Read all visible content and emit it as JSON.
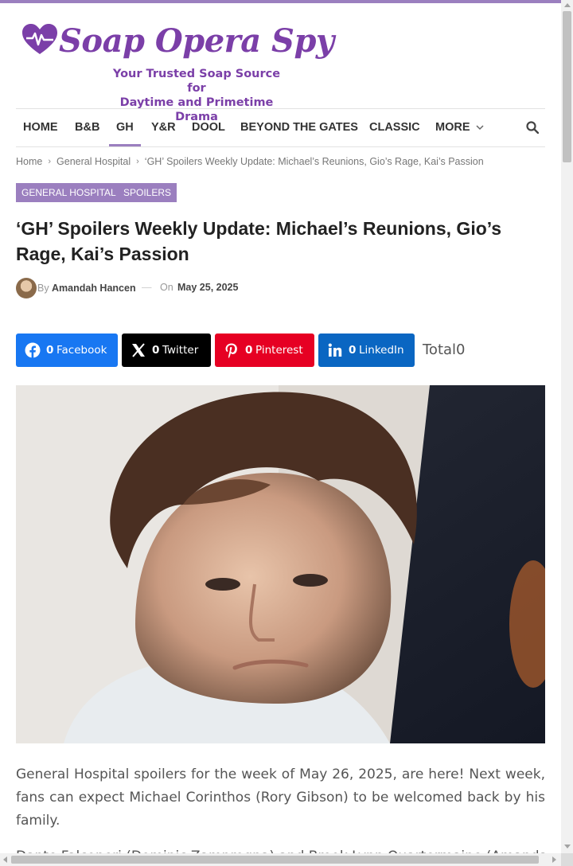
{
  "brand": {
    "name": "Soap Opera Spy",
    "tagline_line1": "Your Trusted Soap Source for",
    "tagline_line2": "Daytime and Primetime Drama",
    "accent_color": "#9b7fbf",
    "logo_color": "#7b3fa8"
  },
  "nav": {
    "items": [
      "HOME",
      "B&B",
      "GH",
      "Y&R",
      "DOOL",
      "BEYOND THE GATES",
      "CLASSIC",
      "MORE"
    ],
    "active": "GH",
    "search_icon": "search-icon"
  },
  "breadcrumb": {
    "items": [
      "Home",
      "General Hospital",
      "‘GH’ Spoilers Weekly Update: Michael’s Reunions, Gio’s Rage, Kai’s Passion"
    ]
  },
  "categories": [
    "GENERAL HOSPITAL",
    "SPOILERS"
  ],
  "article": {
    "title": "‘GH’ Spoilers Weekly Update: Michael’s Reunions, Gio’s Rage, Kai’s Passion",
    "by_label": "By",
    "author": "Amandah Hancen",
    "on_label": "On",
    "date": "May 25, 2025",
    "paragraph1": "General Hospital spoilers for the week of May 26, 2025, are here! Next week, fans can expect Michael Corinthos (Rory Gibson) to be welcomed back by his family.",
    "paragraph2": "Dante Falconeri (Dominic Zamprogna) and Brook Lynn Quartermaine (Amanda"
  },
  "share": {
    "buttons": [
      {
        "network": "Facebook",
        "count": "0",
        "color": "#1877f2",
        "icon": "facebook-icon"
      },
      {
        "network": "Twitter",
        "count": "0",
        "color": "#000000",
        "icon": "x-icon"
      },
      {
        "network": "Pinterest",
        "count": "0",
        "color": "#e60023",
        "icon": "pinterest-icon"
      },
      {
        "network": "LinkedIn",
        "count": "0",
        "color": "#0a66c2",
        "icon": "linkedin-icon"
      }
    ],
    "total_label": "Total",
    "total_count": "0"
  }
}
